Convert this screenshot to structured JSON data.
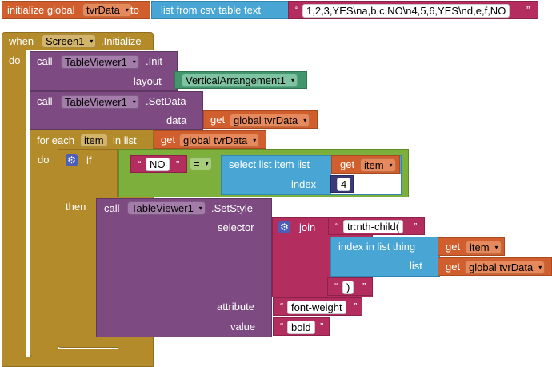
{
  "init": {
    "keyword": "initialize global",
    "var_name": "tvrData",
    "to": "to",
    "csv_label": "list from csv table  text",
    "csv_value": "1,2,3,YES\\na,b,c,NO\\n4,5,6,YES\\nd,e,f,NO"
  },
  "when": {
    "keyword": "when",
    "component": "Screen1",
    "event": ".Initialize",
    "do": "do"
  },
  "call1": {
    "call": "call",
    "component": "TableViewer1",
    "method": ".Init",
    "param": "layout",
    "value": "VerticalArrangement1"
  },
  "call2": {
    "call": "call",
    "component": "TableViewer1",
    "method": ".SetData",
    "param": "data",
    "get": "get",
    "value": "global tvrData"
  },
  "foreach": {
    "label": "for each",
    "var": "item",
    "in_list": "in list",
    "get": "get",
    "value": "global tvrData",
    "do": "do"
  },
  "if": {
    "label": "if",
    "then": "then",
    "no_text": "NO",
    "op": "=",
    "select_label": "select list item  list",
    "get": "get",
    "get_value": "item",
    "index_label": "index",
    "index_value": "4"
  },
  "setstyle": {
    "call": "call",
    "component": "TableViewer1",
    "method": ".SetStyle",
    "selector": "selector",
    "join": "join",
    "s1": "tr:nth-child(",
    "index_in_list": "index in list  thing",
    "get": "get",
    "thing": "item",
    "list": "list",
    "list_value": "global tvrData",
    "s2": ")",
    "attribute": "attribute",
    "attribute_value": "font-weight",
    "value": "value",
    "value_value": "bold"
  },
  "colors": {
    "variable": "#d05f2d",
    "event": "#b38b2b",
    "component": "#7d4b82",
    "list": "#49a6d4",
    "text": "#b32d5e",
    "control": "#7daf3c",
    "arrangement": "#43956e"
  }
}
